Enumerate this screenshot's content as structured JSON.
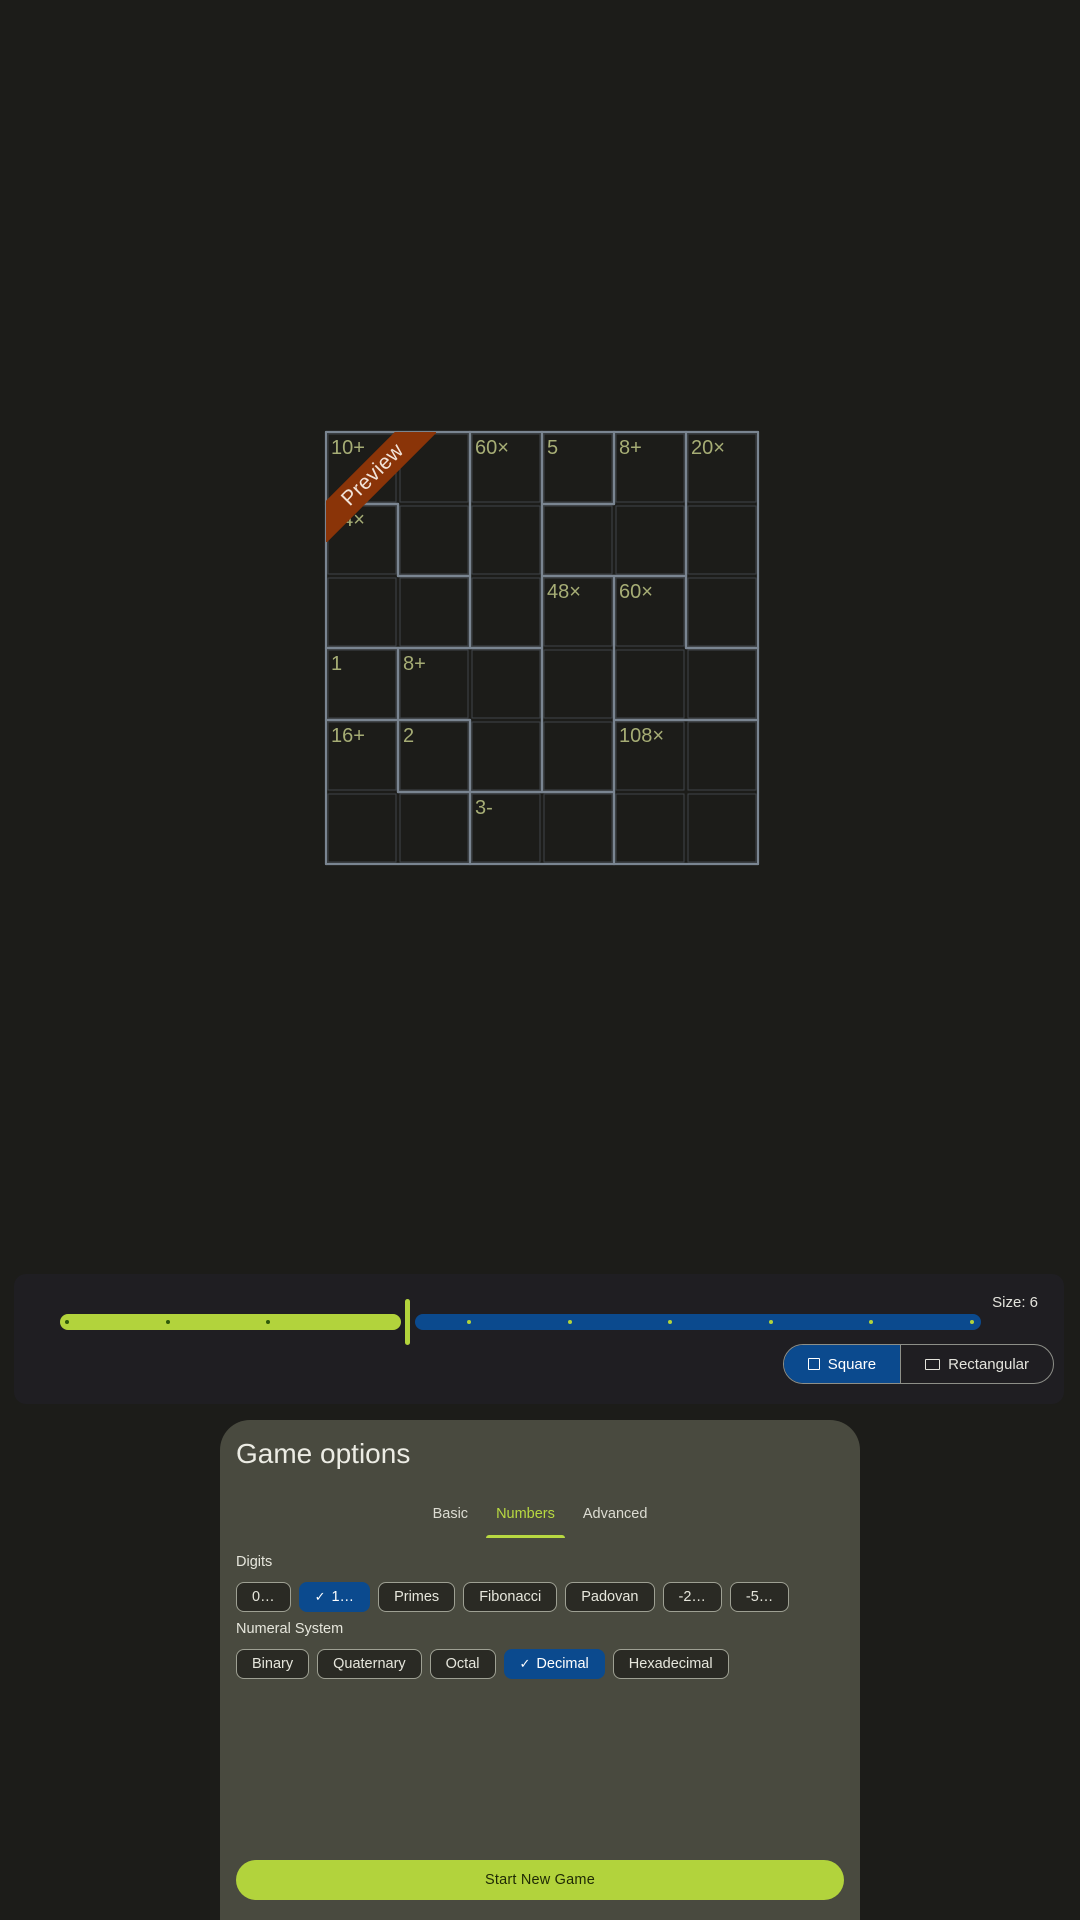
{
  "colors": {
    "background": "#1c1c19",
    "accent_green": "#b2d33c",
    "accent_blue": "#0b4a8e",
    "cage_line": "#7a8591",
    "clue_text": "#a6ad75",
    "ribbon": "#8a3408",
    "card": "#494a3f"
  },
  "preview": {
    "ribbon_label": "Preview",
    "grid_size": 6,
    "cages": [
      {
        "clue": "10+",
        "cells": [
          [
            0,
            0
          ],
          [
            0,
            1
          ],
          [
            1,
            1
          ],
          [
            1,
            0
          ]
        ]
      },
      {
        "clue": "60×",
        "cells": [
          [
            0,
            2
          ],
          [
            1,
            2
          ],
          [
            2,
            2
          ]
        ]
      },
      {
        "clue": "5",
        "cells": [
          [
            0,
            3
          ]
        ]
      },
      {
        "clue": "8+",
        "cells": [
          [
            0,
            4
          ],
          [
            1,
            4
          ],
          [
            1,
            3
          ]
        ]
      },
      {
        "clue": "20×",
        "cells": [
          [
            0,
            5
          ],
          [
            1,
            5
          ],
          [
            2,
            5
          ]
        ]
      },
      {
        "clue": "24×",
        "cells": [
          [
            1,
            0
          ],
          [
            2,
            0
          ],
          [
            2,
            1
          ]
        ]
      },
      {
        "clue": "48×",
        "cells": [
          [
            2,
            3
          ],
          [
            3,
            3
          ],
          [
            4,
            3
          ]
        ]
      },
      {
        "clue": "60×",
        "cells": [
          [
            2,
            4
          ],
          [
            3,
            4
          ],
          [
            3,
            5
          ]
        ]
      },
      {
        "clue": "1",
        "cells": [
          [
            3,
            0
          ]
        ]
      },
      {
        "clue": "8+",
        "cells": [
          [
            3,
            1
          ],
          [
            3,
            2
          ],
          [
            4,
            2
          ]
        ]
      },
      {
        "clue": "16+",
        "cells": [
          [
            4,
            0
          ],
          [
            5,
            0
          ],
          [
            5,
            1
          ]
        ]
      },
      {
        "clue": "2",
        "cells": [
          [
            4,
            1
          ]
        ]
      },
      {
        "clue": "108×",
        "cells": [
          [
            4,
            4
          ],
          [
            4,
            5
          ],
          [
            5,
            4
          ],
          [
            5,
            5
          ]
        ]
      },
      {
        "clue": "3-",
        "cells": [
          [
            5,
            2
          ],
          [
            5,
            3
          ]
        ]
      }
    ]
  },
  "size_panel": {
    "size_label": "Size: 6",
    "slider": {
      "min": 3,
      "max": 12,
      "value": 6,
      "ticks": 10
    },
    "shape_options": [
      {
        "label": "Square",
        "icon": "square-icon",
        "selected": true
      },
      {
        "label": "Rectangular",
        "icon": "rectangle-icon",
        "selected": false
      }
    ]
  },
  "options": {
    "title": "Game options",
    "tabs": [
      {
        "label": "Basic",
        "active": false
      },
      {
        "label": "Numbers",
        "active": true
      },
      {
        "label": "Advanced",
        "active": false
      }
    ],
    "digits_label": "Digits",
    "digits": [
      {
        "label": "0…",
        "selected": false
      },
      {
        "label": "1…",
        "selected": true
      },
      {
        "label": "Primes",
        "selected": false
      },
      {
        "label": "Fibonacci",
        "selected": false
      },
      {
        "label": "Padovan",
        "selected": false
      },
      {
        "label": "-2…",
        "selected": false
      },
      {
        "label": "-5…",
        "selected": false
      }
    ],
    "numeral_label": "Numeral System",
    "numeral_systems": [
      {
        "label": "Binary",
        "selected": false
      },
      {
        "label": "Quaternary",
        "selected": false
      },
      {
        "label": "Octal",
        "selected": false
      },
      {
        "label": "Decimal",
        "selected": true
      },
      {
        "label": "Hexadecimal",
        "selected": false
      }
    ],
    "start_button": "Start New Game"
  }
}
